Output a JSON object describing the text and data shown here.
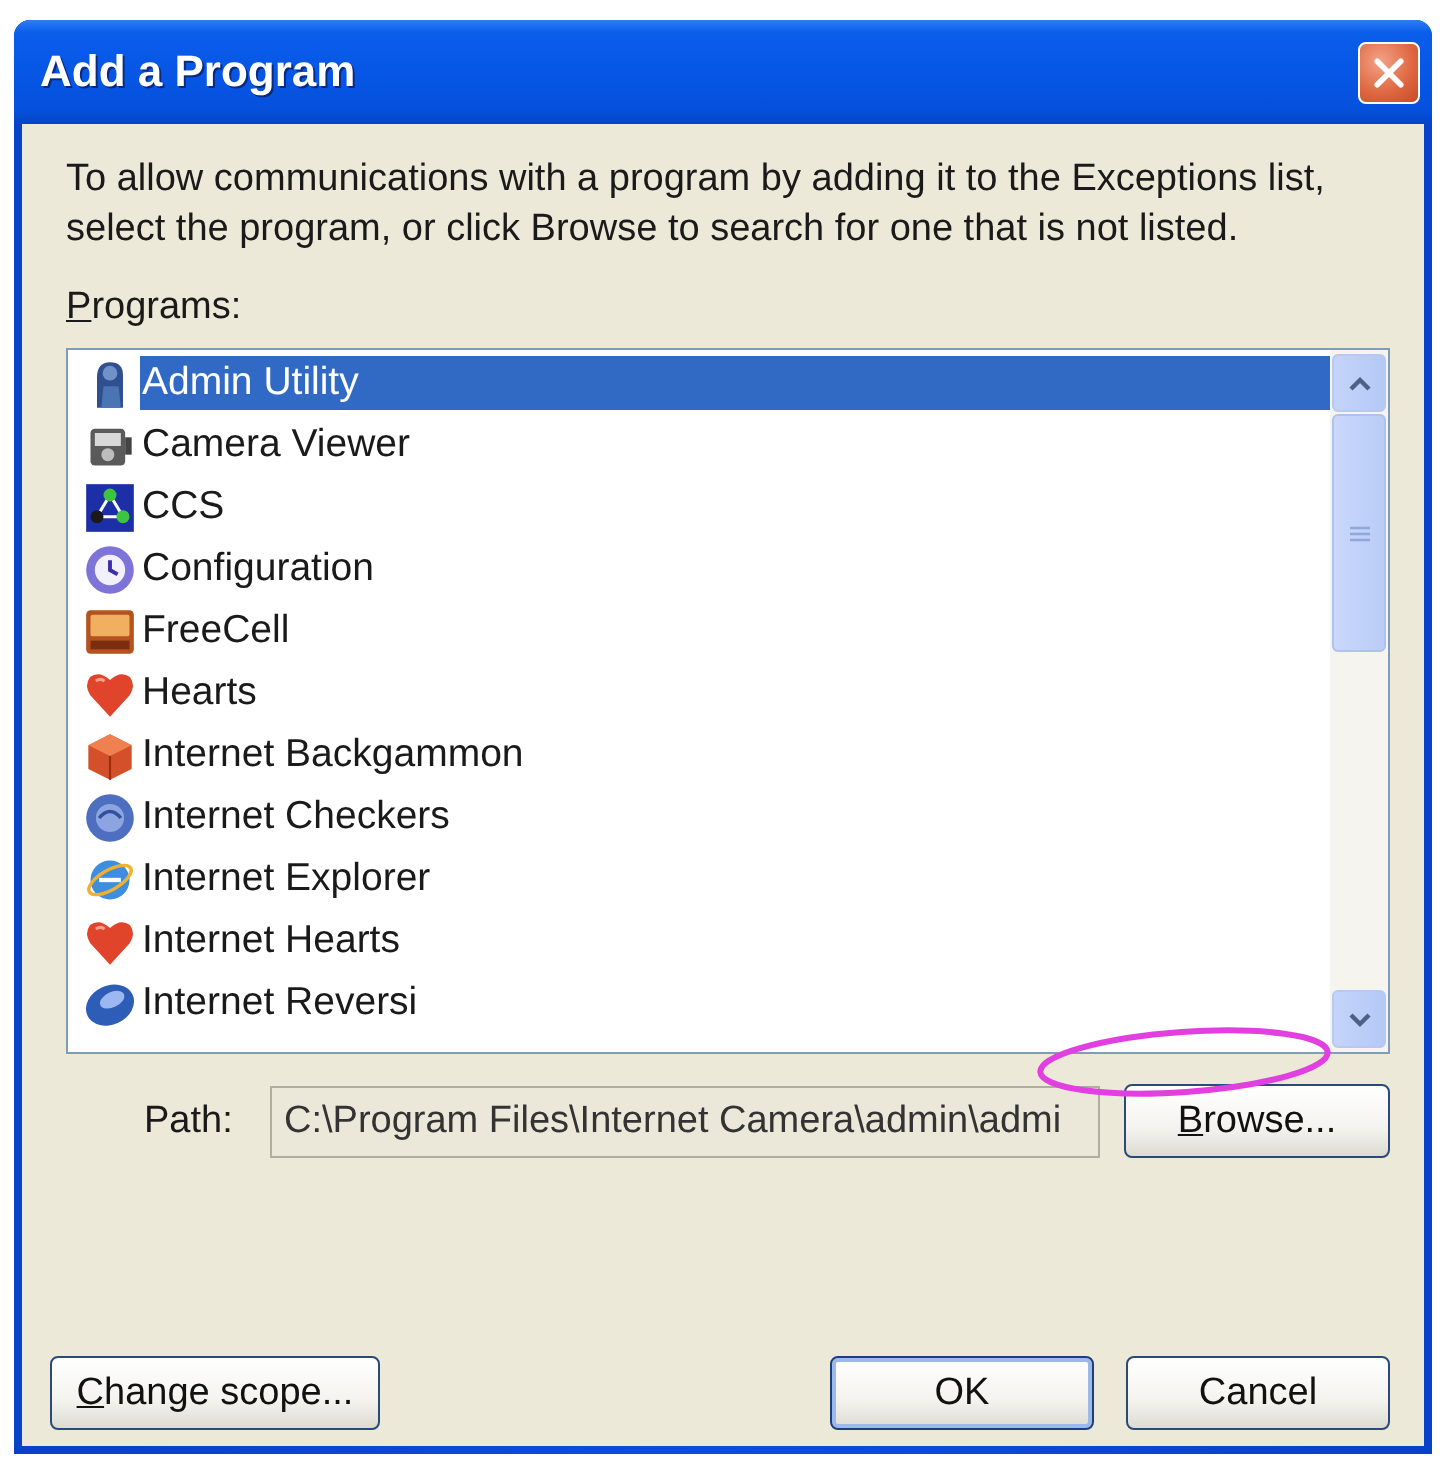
{
  "window": {
    "title": "Add a Program",
    "close_button": true
  },
  "description": "To allow communications with a program by adding it to the Exceptions list,\nselect the program, or click Browse to search for one that is not listed.",
  "programs": {
    "label": "Programs:",
    "mnemonic": true,
    "items": [
      {
        "name": "Admin Utility",
        "selected": true
      },
      {
        "name": "Camera Viewer",
        "selected": false
      },
      {
        "name": "CCS",
        "selected": false
      },
      {
        "name": "Configuration",
        "selected": false
      },
      {
        "name": "FreeCell",
        "selected": false
      },
      {
        "name": "Hearts",
        "selected": false
      },
      {
        "name": "Internet Backgammon",
        "selected": false
      },
      {
        "name": "Internet Checkers",
        "selected": false
      },
      {
        "name": "Internet Explorer",
        "selected": false
      },
      {
        "name": "Internet Hearts",
        "selected": false
      },
      {
        "name": "Internet Reversi",
        "selected": false
      }
    ]
  },
  "path": {
    "label": "Path:",
    "value": "C:\\Program Files\\Internet Camera\\admin\\admi",
    "read_only": true
  },
  "browse_button": {
    "label": "Browse...",
    "mnemonic": true
  },
  "footer": {
    "left_buttons": [
      {
        "label": "Change scope...",
        "mnemonic": true,
        "default": false
      }
    ],
    "right_buttons": [
      {
        "label": "OK",
        "mnemonic": false,
        "default": true
      },
      {
        "label": "Cancel",
        "mnemonic": false,
        "default": false
      }
    ]
  },
  "annotations": [
    {
      "kind": "ellipse"
    }
  ]
}
